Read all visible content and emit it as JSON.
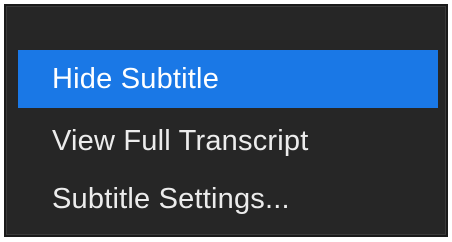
{
  "context_menu": {
    "items": [
      {
        "label": "Hide Subtitle",
        "highlighted": true
      },
      {
        "label": "View Full Transcript",
        "highlighted": false
      },
      {
        "label": "Subtitle Settings...",
        "highlighted": false
      }
    ]
  },
  "colors": {
    "menu_background": "#262626",
    "highlight": "#1a78e6",
    "text": "#ececec"
  }
}
